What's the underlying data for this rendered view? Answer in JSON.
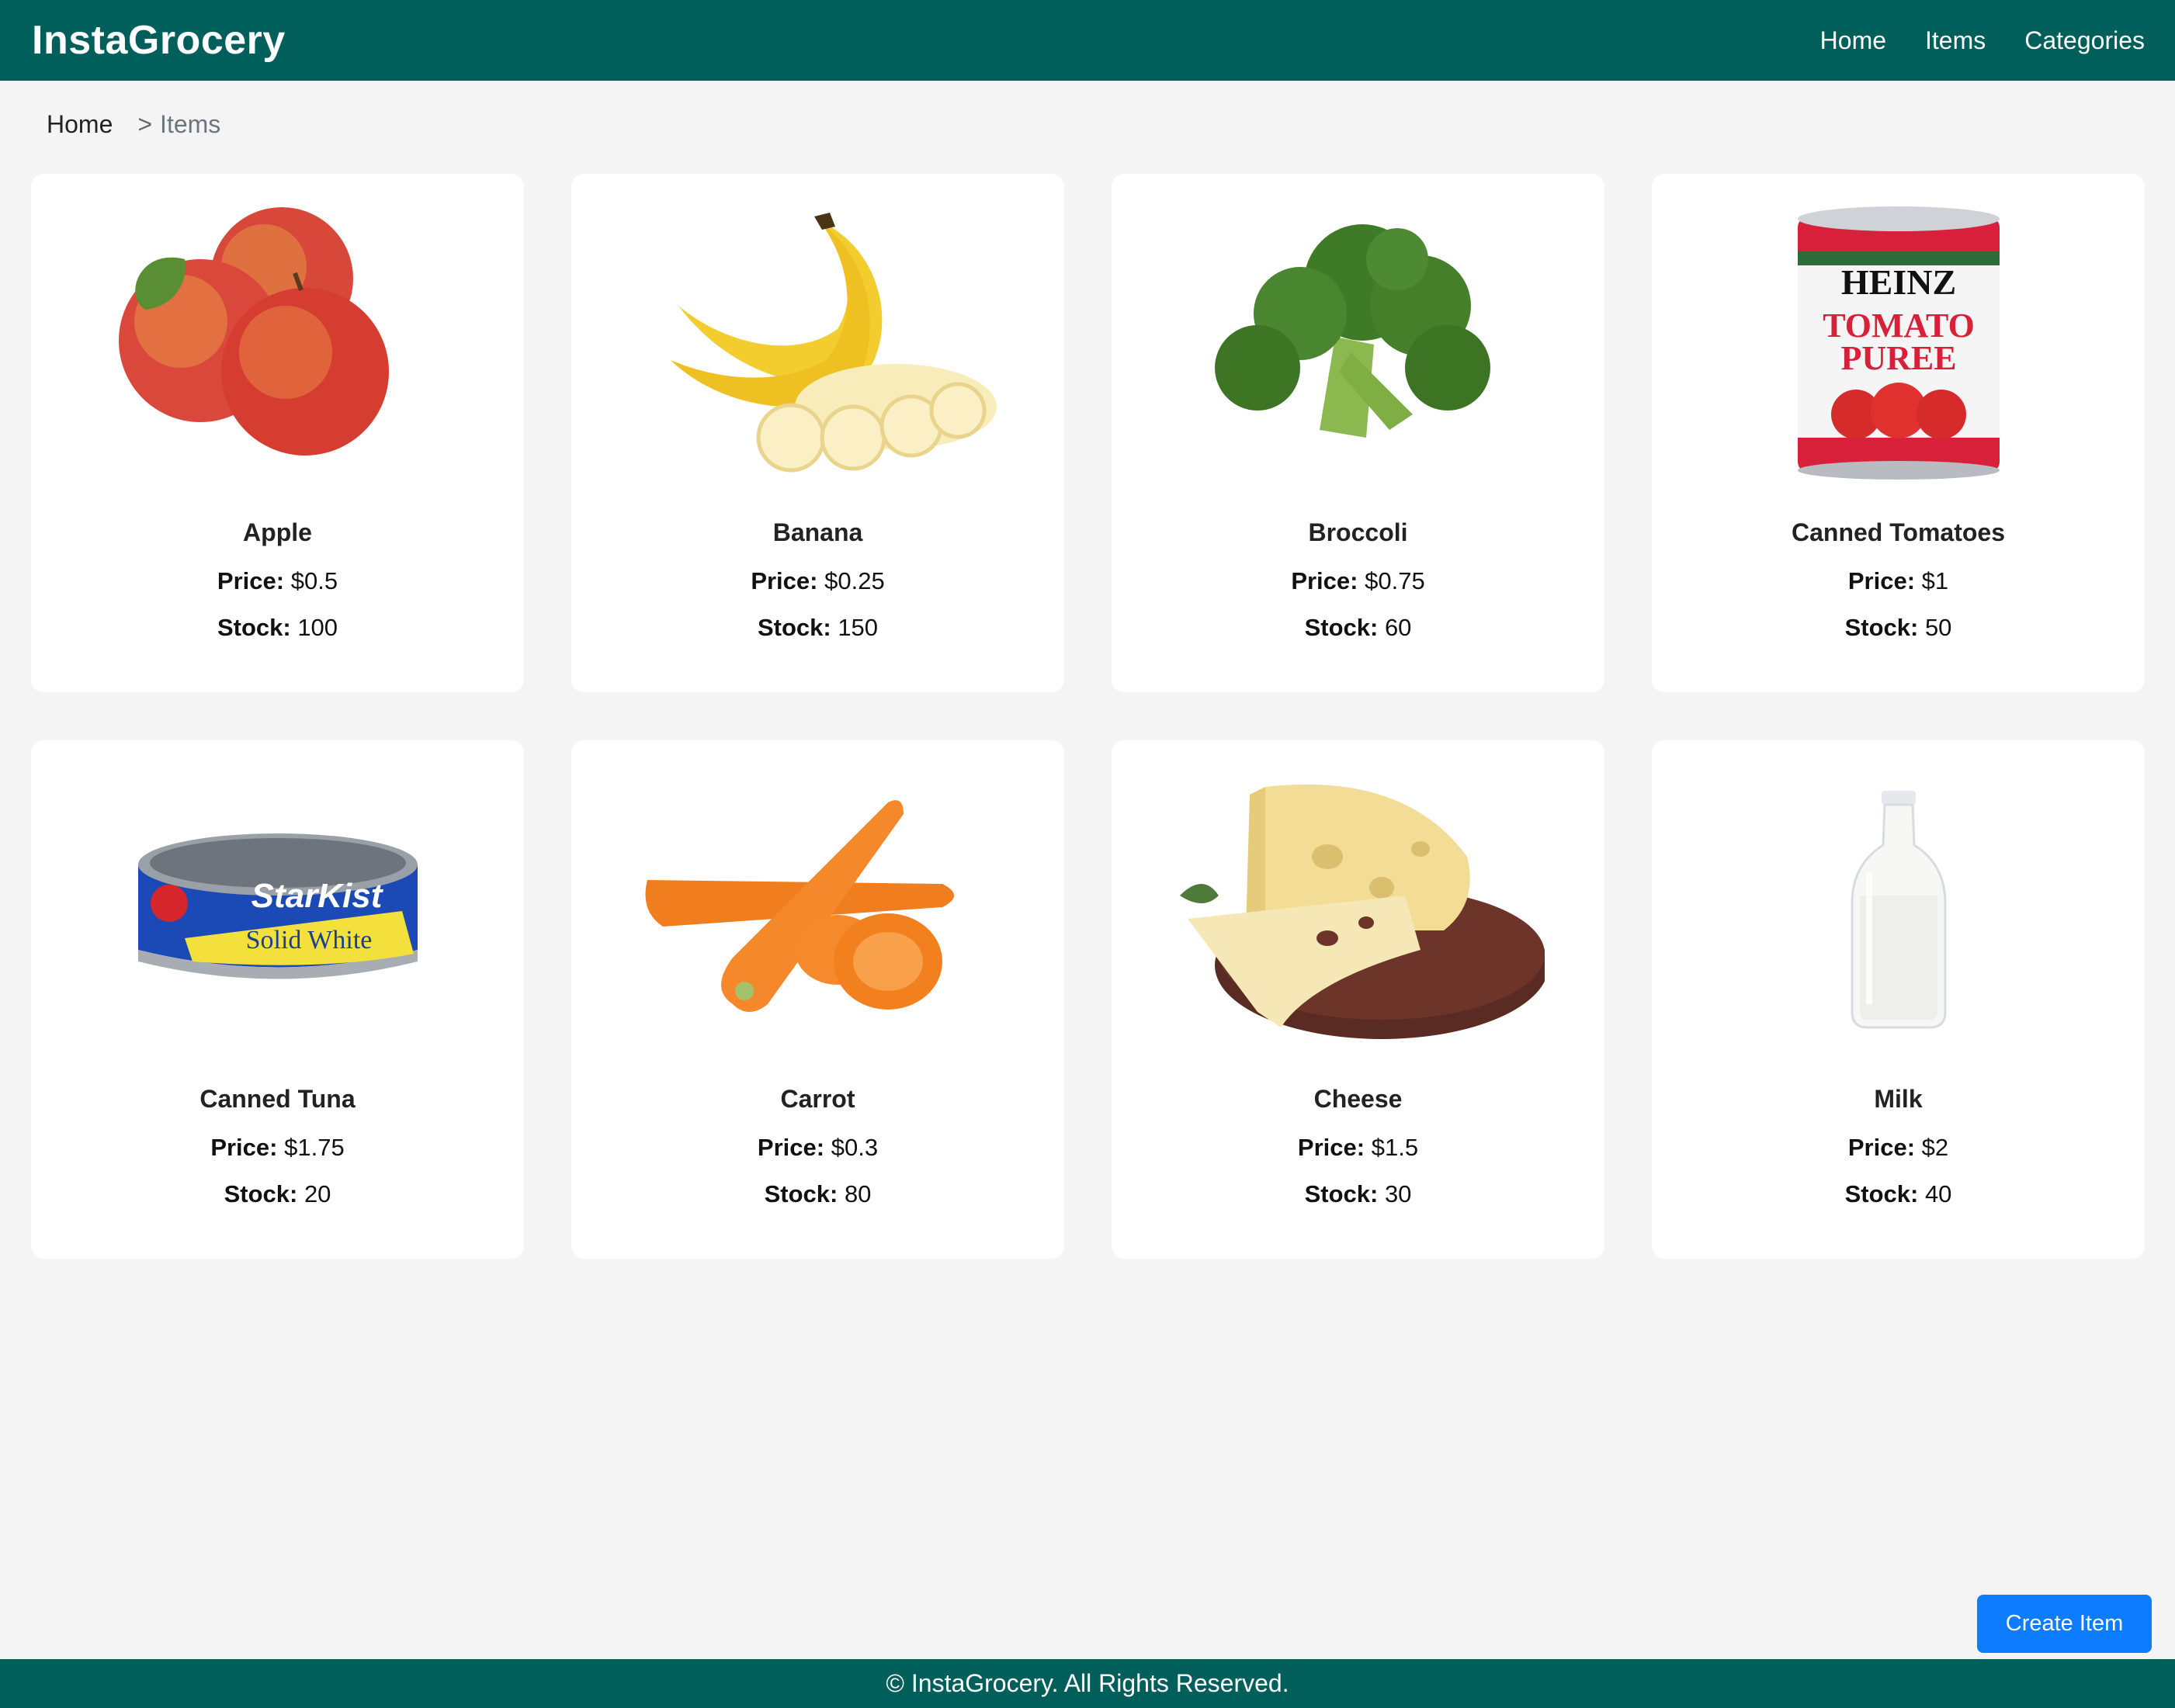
{
  "header": {
    "brand": "InstaGrocery",
    "nav": [
      "Home",
      "Items",
      "Categories"
    ]
  },
  "breadcrumb": {
    "home": "Home",
    "separator": ">",
    "current": "Items"
  },
  "labels": {
    "price": "Price:",
    "stock": "Stock:"
  },
  "items": [
    {
      "name": "Apple",
      "price": "$0.5",
      "stock": "100",
      "icon": "apple-image"
    },
    {
      "name": "Banana",
      "price": "$0.25",
      "stock": "150",
      "icon": "banana-image"
    },
    {
      "name": "Broccoli",
      "price": "$0.75",
      "stock": "60",
      "icon": "broccoli-image"
    },
    {
      "name": "Canned Tomatoes",
      "price": "$1",
      "stock": "50",
      "icon": "canned-tomatoes-image"
    },
    {
      "name": "Canned Tuna",
      "price": "$1.75",
      "stock": "20",
      "icon": "canned-tuna-image"
    },
    {
      "name": "Carrot",
      "price": "$0.3",
      "stock": "80",
      "icon": "carrot-image"
    },
    {
      "name": "Cheese",
      "price": "$1.5",
      "stock": "30",
      "icon": "cheese-image"
    },
    {
      "name": "Milk",
      "price": "$2",
      "stock": "40",
      "icon": "milk-image"
    }
  ],
  "image_text": {
    "tomato_brand": "HEINZ",
    "tomato_line1": "TOMATO",
    "tomato_line2": "PUREE",
    "tuna_brand": "StarKist",
    "tuna_line": "Solid White"
  },
  "actions": {
    "create": "Create Item"
  },
  "footer": {
    "text": "© InstaGrocery. All Rights Reserved."
  },
  "colors": {
    "brand": "#005f5b",
    "primary_button": "#0d7cff",
    "background": "#f4f4f4"
  }
}
